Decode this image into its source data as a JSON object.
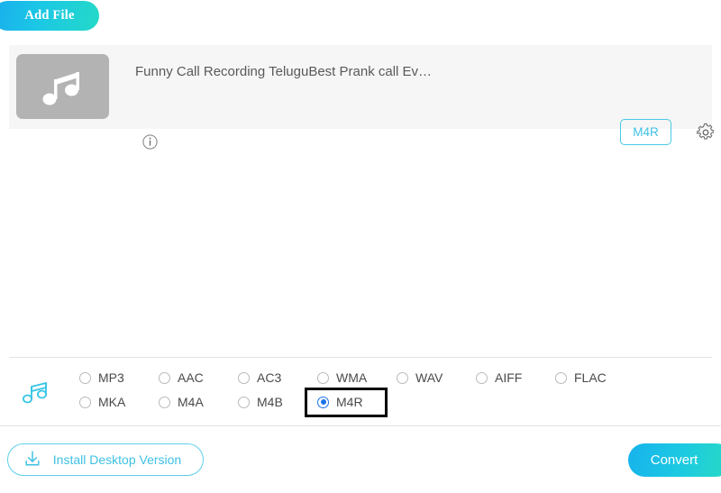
{
  "toolbar": {
    "add_file_label": "Add File"
  },
  "file_row": {
    "title": "Funny Call Recording TeluguBest Prank call Ev…",
    "thumbnail_icon": "music-note-icon",
    "info_icon": "info-circle-icon",
    "format_badge": "M4R",
    "settings_icon": "gear-icon"
  },
  "format_section": {
    "note_icon": "music-note-icon",
    "selected_format": "M4R",
    "rows": [
      [
        {
          "label": "MP3",
          "selected": false
        },
        {
          "label": "AAC",
          "selected": false
        },
        {
          "label": "AC3",
          "selected": false
        },
        {
          "label": "WMA",
          "selected": false
        },
        {
          "label": "WAV",
          "selected": false
        },
        {
          "label": "AIFF",
          "selected": false
        },
        {
          "label": "FLAC",
          "selected": false
        }
      ],
      [
        {
          "label": "MKA",
          "selected": false
        },
        {
          "label": "M4A",
          "selected": false
        },
        {
          "label": "M4B",
          "selected": false
        },
        {
          "label": "M4R",
          "selected": true
        }
      ]
    ]
  },
  "footer": {
    "install_label": "Install Desktop Version",
    "install_icon": "download-icon",
    "convert_label": "Convert"
  },
  "colors": {
    "accent_cyan": "#3ec1e3",
    "gradient_start": "#17b3ec",
    "gradient_end": "#27dbc2",
    "radio_selected": "#1a73e8",
    "panel_bg": "#f6f6f6",
    "thumb_bg": "#b3b3b3",
    "highlight_border": "#000000"
  }
}
